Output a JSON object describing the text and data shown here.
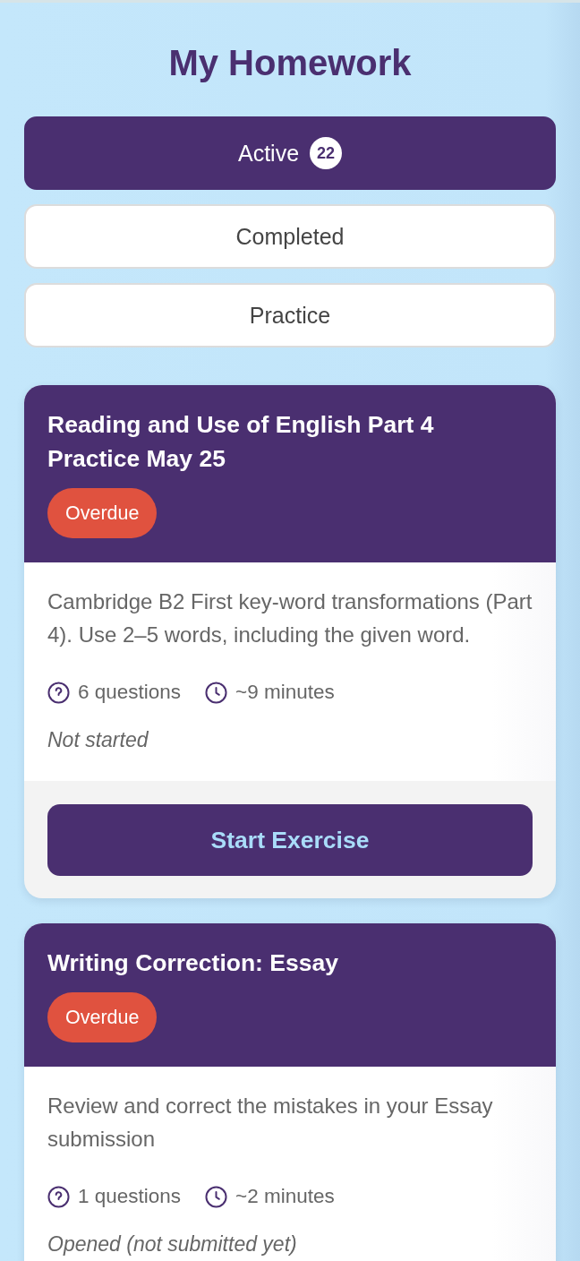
{
  "title": "My Homework",
  "tabs": [
    {
      "label": "Active",
      "count": "22",
      "selected": true
    },
    {
      "label": "Completed",
      "selected": false
    },
    {
      "label": "Practice",
      "selected": false
    }
  ],
  "assignments": [
    {
      "title": "Reading and Use of English Part 4 Practice May 25",
      "badge": "Overdue",
      "description": "Cambridge B2 First key-word transformations (Part 4). Use 2–5 words, including the given word.",
      "questions": "6 questions",
      "duration": "~9 minutes",
      "progress": "Not started",
      "action": "Start Exercise"
    },
    {
      "title": "Writing Correction: Essay",
      "badge": "Overdue",
      "description": "Review and correct the mistakes in your Essay submission",
      "questions": "1 questions",
      "duration": "~2 minutes",
      "progress": "Opened (not submitted yet)"
    }
  ]
}
